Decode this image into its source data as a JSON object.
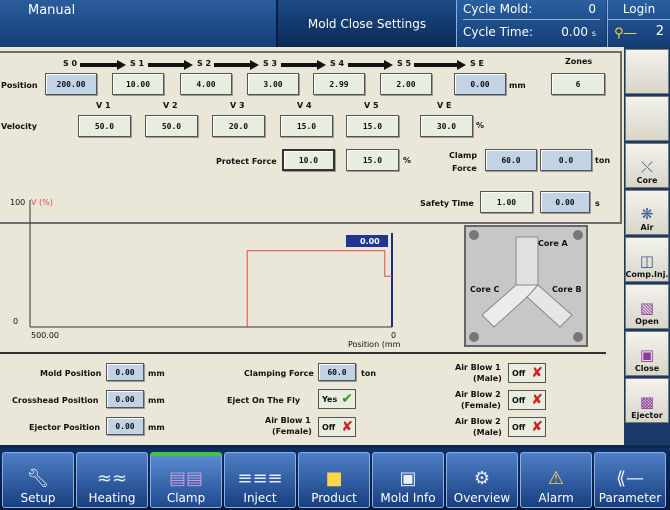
{
  "header": {
    "mode": "Manual",
    "title": "Mold Close Settings",
    "cycle_mold_label": "Cycle Mold:",
    "cycle_mold_value": "0",
    "cycle_time_label": "Cycle Time:",
    "cycle_time_value": "0.00",
    "cycle_time_unit": "s",
    "login_label": "Login",
    "login_level": "2"
  },
  "stages": {
    "labels": [
      "S 0",
      "S 1",
      "S 2",
      "S 3",
      "S 4",
      "S 5",
      "S E"
    ],
    "position_label": "Position",
    "positions": [
      "200.00",
      "10.00",
      "4.00",
      "3.00",
      "2.99",
      "2.00",
      "0.00"
    ],
    "position_unit": "mm",
    "zones_label": "Zones",
    "zones_value": "6",
    "velocity_labels": [
      "V 1",
      "V 2",
      "V 3",
      "V 4",
      "V 5",
      "V E"
    ],
    "velocity_label": "Velocity",
    "velocities": [
      "50.0",
      "50.0",
      "20.0",
      "15.0",
      "15.0",
      "30.0"
    ],
    "velocity_unit": "%",
    "protect_force_label": "Protect Force",
    "protect_force_1": "10.0",
    "protect_force_2": "15.0",
    "protect_force_unit": "%",
    "clamp_force_label_1": "Clamp",
    "clamp_force_label_2": "Force",
    "clamp_force_1": "60.0",
    "clamp_force_2": "0.0",
    "clamp_force_unit": "ton"
  },
  "chart_data": {
    "type": "line",
    "y_top_label": "100",
    "y_series_label": "V (%)",
    "y_zero_label": "0",
    "x_left_label": "500.00",
    "x_right_label": "0",
    "xlabel": "Position (mm)",
    "current_value": "0.00",
    "xlim": [
      500,
      0
    ],
    "ylim": [
      0,
      100
    ],
    "profile": [
      [
        200,
        0
      ],
      [
        200,
        60
      ],
      [
        10,
        60
      ],
      [
        10,
        40
      ],
      [
        0,
        40
      ]
    ]
  },
  "safety": {
    "label": "Safety Time",
    "value_1": "1.00",
    "value_2": "0.00",
    "unit": "s"
  },
  "cores": {
    "core_a": "Core A",
    "core_b": "Core B",
    "core_c": "Core C"
  },
  "status": {
    "mold_position_label": "Mold Position",
    "mold_position_value": "0.00",
    "crosshead_position_label": "Crosshead Position",
    "crosshead_position_value": "0.00",
    "ejector_position_label": "Ejector Position",
    "ejector_position_value": "0.00",
    "position_unit": "mm",
    "clamping_force_label": "Clamping Force",
    "clamping_force_value": "60.0",
    "clamping_force_unit": "ton",
    "eject_on_fly_label": "Eject On The Fly",
    "eject_on_fly_value": "Yes",
    "air_blow_1_female_label_1": "Air Blow 1",
    "air_blow_1_female_label_2": "(Female)",
    "air_blow_1_female_value": "Off",
    "air_blow_1_male_label_1": "Air Blow 1",
    "air_blow_1_male_label_2": "(Male)",
    "air_blow_1_male_value": "Off",
    "air_blow_2_female_label_1": "Air Blow 2",
    "air_blow_2_female_label_2": "(Female)",
    "air_blow_2_female_value": "Off",
    "air_blow_2_male_label_1": "Air Blow 2",
    "air_blow_2_male_label_2": "(Male)",
    "air_blow_2_male_value": "Off"
  },
  "sidebar": {
    "items": [
      {
        "label": "",
        "icon": "blank"
      },
      {
        "label": "",
        "icon": "blank"
      },
      {
        "label": "Core",
        "icon": "core-icon"
      },
      {
        "label": "Air",
        "icon": "air-icon"
      },
      {
        "label": "Comp.Inj.",
        "icon": "comp-inj-icon"
      },
      {
        "label": "Open",
        "icon": "open-icon"
      },
      {
        "label": "Close",
        "icon": "close-icon"
      },
      {
        "label": "Ejector",
        "icon": "ejector-icon"
      }
    ]
  },
  "nav": {
    "items": [
      {
        "label": "Setup",
        "icon": "wrench-icon"
      },
      {
        "label": "Heating",
        "icon": "heater-icon"
      },
      {
        "label": "Clamp",
        "icon": "clamp-icon"
      },
      {
        "label": "Inject",
        "icon": "screw-icon"
      },
      {
        "label": "Product",
        "icon": "product-icon"
      },
      {
        "label": "Mold Info",
        "icon": "mold-icon"
      },
      {
        "label": "Overview",
        "icon": "machine-icon"
      },
      {
        "label": "Alarm",
        "icon": "alarm-icon"
      },
      {
        "label": "Parameter",
        "icon": "caliper-icon"
      }
    ],
    "active": "Clamp"
  },
  "colors": {
    "panel": "#ebe7d8",
    "field": "#e8eedf",
    "field_blue": "#c3d3e6",
    "chart_profile": "#e04848",
    "nav_active_bar": "#43c04a",
    "toggle_off": "#d02020",
    "toggle_yes": "#2c9a2c"
  }
}
